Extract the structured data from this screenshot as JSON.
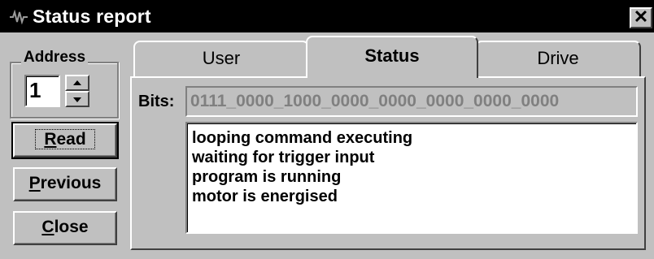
{
  "window": {
    "title": "Status report",
    "close_glyph": "✕"
  },
  "address": {
    "label": "Address",
    "value": "1"
  },
  "buttons": {
    "read_label": "Read",
    "previous_label": "Previous",
    "close_label": "Close"
  },
  "tabs": [
    {
      "label": "User"
    },
    {
      "label": "Status"
    },
    {
      "label": "Drive"
    }
  ],
  "bits": {
    "label": "Bits:",
    "value": "0111_0000_1000_0000_0000_0000_0000_0000"
  },
  "status_lines": [
    "looping command executing",
    "waiting for trigger input",
    "program is running",
    "motor is energised"
  ],
  "icons": {
    "app": "app-wave-icon",
    "close": "close-icon",
    "spin_up": "spin-up-icon",
    "spin_down": "spin-down-icon"
  }
}
